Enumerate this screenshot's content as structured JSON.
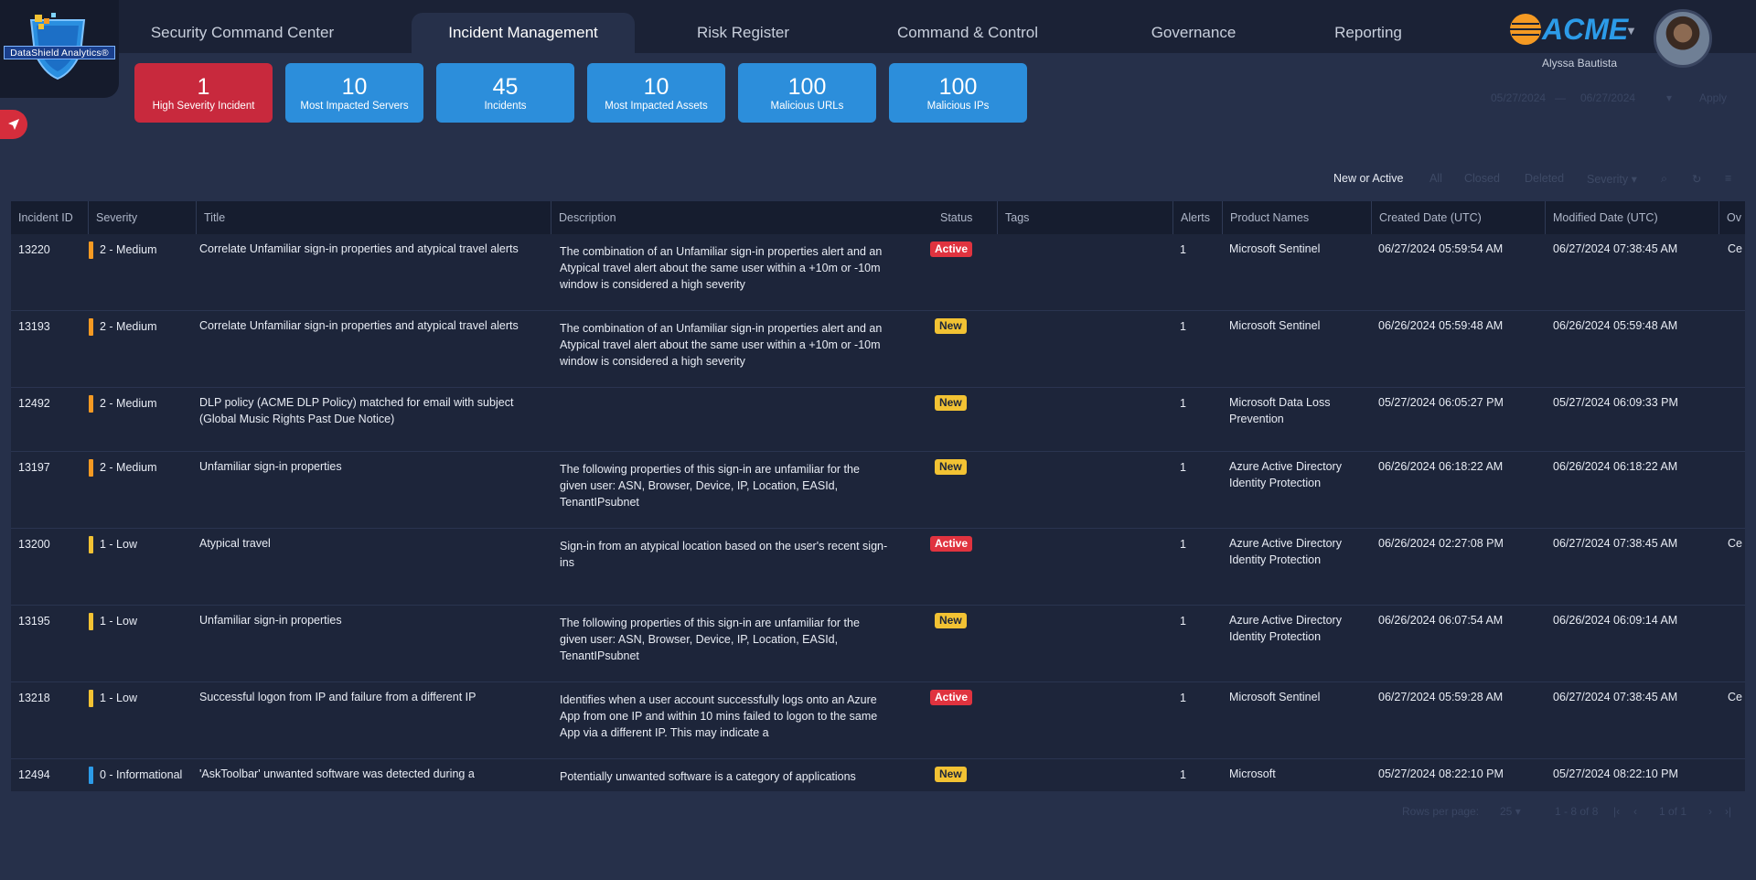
{
  "logo": {
    "text": "DataShield Analytics®"
  },
  "nav": {
    "tabs": [
      {
        "label": "Security Command Center"
      },
      {
        "label": "Incident Management"
      },
      {
        "label": "Risk Register"
      },
      {
        "label": "Command & Control"
      },
      {
        "label": "Governance"
      },
      {
        "label": "Reporting"
      }
    ],
    "active_tab": "Incident Management"
  },
  "brand": {
    "name": "ACME"
  },
  "user": {
    "name": "Alyssa Bautista"
  },
  "kpis": [
    {
      "value": "1",
      "label": "High Severity Incident",
      "color": "#c8293d"
    },
    {
      "value": "10",
      "label": "Most Impacted Servers",
      "color": "#2c8edb"
    },
    {
      "value": "45",
      "label": "Incidents",
      "color": "#2c8edb"
    },
    {
      "value": "10",
      "label": "Most Impacted Assets",
      "color": "#2c8edb"
    },
    {
      "value": "100",
      "label": "Malicious URLs",
      "color": "#2c8edb"
    },
    {
      "value": "100",
      "label": "Malicious IPs",
      "color": "#2c8edb"
    }
  ],
  "date_filter": {
    "start": "05/27/2024",
    "separator": "—",
    "end": "06/27/2024",
    "apply_label": "Apply"
  },
  "toolbar": {
    "filters": [
      "New or Active",
      "All",
      "Closed",
      "Deleted"
    ],
    "active_filter": "New or Active",
    "severity_label": "Severity"
  },
  "table": {
    "columns": [
      "Incident ID",
      "Severity",
      "Title",
      "Description",
      "Status",
      "Tags",
      "Alerts",
      "Product Names",
      "Created Date (UTC)",
      "Modified Date (UTC)",
      "Ov"
    ],
    "rows": [
      {
        "id": "13220",
        "severity": "2 - Medium",
        "sev_color": "#f59a23",
        "title": "Correlate Unfamiliar sign-in properties and atypical travel alerts",
        "description": "The combination of an Unfamiliar sign-in properties alert and an Atypical travel alert about the same user within a +10m or -10m window is considered a high severity",
        "status": "Active",
        "tags": "",
        "alerts": "1",
        "product": "Microsoft Sentinel",
        "created": "06/27/2024 05:59:54 AM",
        "modified": "06/27/2024 07:38:45 AM",
        "owner": "Ce"
      },
      {
        "id": "13193",
        "severity": "2 - Medium",
        "sev_color": "#f59a23",
        "title": "Correlate Unfamiliar sign-in properties and atypical travel alerts",
        "description": "The combination of an Unfamiliar sign-in properties alert and an Atypical travel alert about the same user within a +10m or -10m window is considered a high severity",
        "status": "New",
        "tags": "",
        "alerts": "1",
        "product": "Microsoft Sentinel",
        "created": "06/26/2024 05:59:48 AM",
        "modified": "06/26/2024 05:59:48 AM",
        "owner": ""
      },
      {
        "id": "12492",
        "severity": "2 - Medium",
        "sev_color": "#f59a23",
        "title": "DLP policy (ACME DLP Policy) matched for email with subject (Global Music Rights Past Due Notice)",
        "description": "",
        "status": "New",
        "tags": "",
        "alerts": "1",
        "product": "Microsoft Data Loss Prevention",
        "created": "05/27/2024 06:05:27 PM",
        "modified": "05/27/2024 06:09:33 PM",
        "owner": ""
      },
      {
        "id": "13197",
        "severity": "2 - Medium",
        "sev_color": "#f59a23",
        "title": "Unfamiliar sign-in properties",
        "description": "The following properties of this sign-in are unfamiliar for the given user: ASN, Browser, Device, IP, Location, EASId, TenantIPsubnet",
        "status": "New",
        "tags": "",
        "alerts": "1",
        "product": "Azure Active Directory Identity Protection",
        "created": "06/26/2024 06:18:22 AM",
        "modified": "06/26/2024 06:18:22 AM",
        "owner": ""
      },
      {
        "id": "13200",
        "severity": "1 - Low",
        "sev_color": "#f2c233",
        "title": "Atypical travel",
        "description": "Sign-in from an atypical location based on the user's recent sign-ins",
        "status": "Active",
        "tags": "",
        "alerts": "1",
        "product": "Azure Active Directory Identity Protection",
        "created": "06/26/2024 02:27:08 PM",
        "modified": "06/27/2024 07:38:45 AM",
        "owner": "Ce"
      },
      {
        "id": "13195",
        "severity": "1 - Low",
        "sev_color": "#f2c233",
        "title": "Unfamiliar sign-in properties",
        "description": "The following properties of this sign-in are unfamiliar for the given user: ASN, Browser, Device, IP, Location, EASId, TenantIPsubnet",
        "status": "New",
        "tags": "",
        "alerts": "1",
        "product": "Azure Active Directory Identity Protection",
        "created": "06/26/2024 06:07:54 AM",
        "modified": "06/26/2024 06:09:14 AM",
        "owner": ""
      },
      {
        "id": "13218",
        "severity": "1 - Low",
        "sev_color": "#f2c233",
        "title": "Successful logon from IP and failure from a different IP",
        "description": "Identifies when a user account successfully logs onto an Azure App from one IP and within 10 mins failed to logon to the same App via a different IP. This may indicate a",
        "status": "Active",
        "tags": "",
        "alerts": "1",
        "product": "Microsoft Sentinel",
        "created": "06/27/2024 05:59:28 AM",
        "modified": "06/27/2024 07:38:45 AM",
        "owner": "Ce"
      },
      {
        "id": "12494",
        "severity": "0 - Informational",
        "sev_color": "#2c9be8",
        "title": "'AskToolbar' unwanted software was detected during a",
        "description": "Potentially unwanted software is a category of applications",
        "status": "New",
        "tags": "",
        "alerts": "1",
        "product": "Microsoft",
        "created": "05/27/2024 08:22:10 PM",
        "modified": "05/27/2024 08:22:10 PM",
        "owner": ""
      }
    ]
  },
  "pagination": {
    "rows_per_page_label": "Rows per page:",
    "rows_per_page": "25",
    "range": "1 - 8 of 8",
    "page": "1 of 1"
  }
}
